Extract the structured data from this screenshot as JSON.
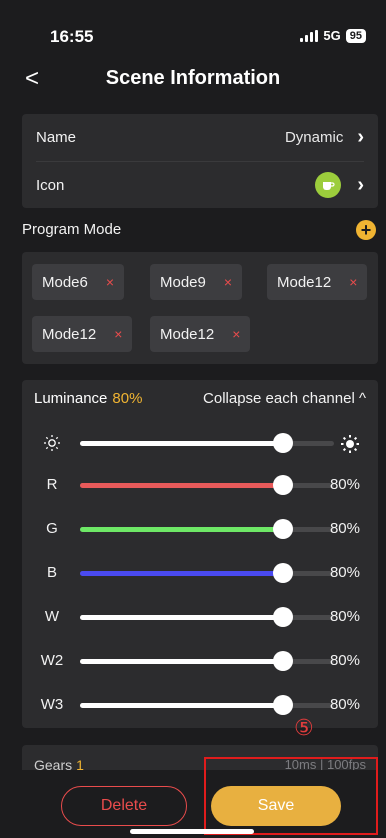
{
  "status_bar": {
    "time": "16:55",
    "network": "5G",
    "battery": "95"
  },
  "nav": {
    "back_glyph": "<",
    "title": "Scene Information"
  },
  "info": {
    "name_label": "Name",
    "name_value": "Dynamic",
    "icon_label": "Icon",
    "icon_name": "coffee-cup-icon",
    "icon_color": "#9ccd3c"
  },
  "program_mode": {
    "title": "Program Mode",
    "add_glyph": "+",
    "modes": [
      {
        "label": "Mode6",
        "remove": "×"
      },
      {
        "label": "Mode9",
        "remove": "×"
      },
      {
        "label": "Mode12",
        "remove": "×"
      },
      {
        "label": "Mode12",
        "remove": "×"
      },
      {
        "label": "Mode12",
        "remove": "×"
      }
    ]
  },
  "luminance": {
    "label": "Luminance",
    "percent": "80%",
    "collapse_label": "Collapse each channel ^",
    "channels": [
      {
        "label": "",
        "value_text": "",
        "level": 0.8,
        "color": "#ffffff",
        "icon": "dim-sun-icon",
        "right_icon": "bright-sun-icon"
      },
      {
        "label": "R",
        "value_text": "80%",
        "level": 0.8,
        "color": "#e85a5a"
      },
      {
        "label": "G",
        "value_text": "80%",
        "level": 0.8,
        "color": "#6ee866"
      },
      {
        "label": "B",
        "value_text": "80%",
        "level": 0.8,
        "color": "#4a4af0"
      },
      {
        "label": "W",
        "value_text": "80%",
        "level": 0.8,
        "color": "#ffffff"
      },
      {
        "label": "W2",
        "value_text": "80%",
        "level": 0.8,
        "color": "#ffffff"
      },
      {
        "label": "W3",
        "value_text": "80%",
        "level": 0.8,
        "color": "#ffffff"
      }
    ]
  },
  "annotation": {
    "marker": "⑤"
  },
  "gears": {
    "label": "Gears",
    "count": "1",
    "right_text": "10ms  |  100fps"
  },
  "actions": {
    "delete_label": "Delete",
    "save_label": "Save"
  },
  "colors": {
    "accent": "#f0b432",
    "danger": "#e94c4c",
    "save": "#e8b040",
    "card": "#2c2c2e"
  }
}
